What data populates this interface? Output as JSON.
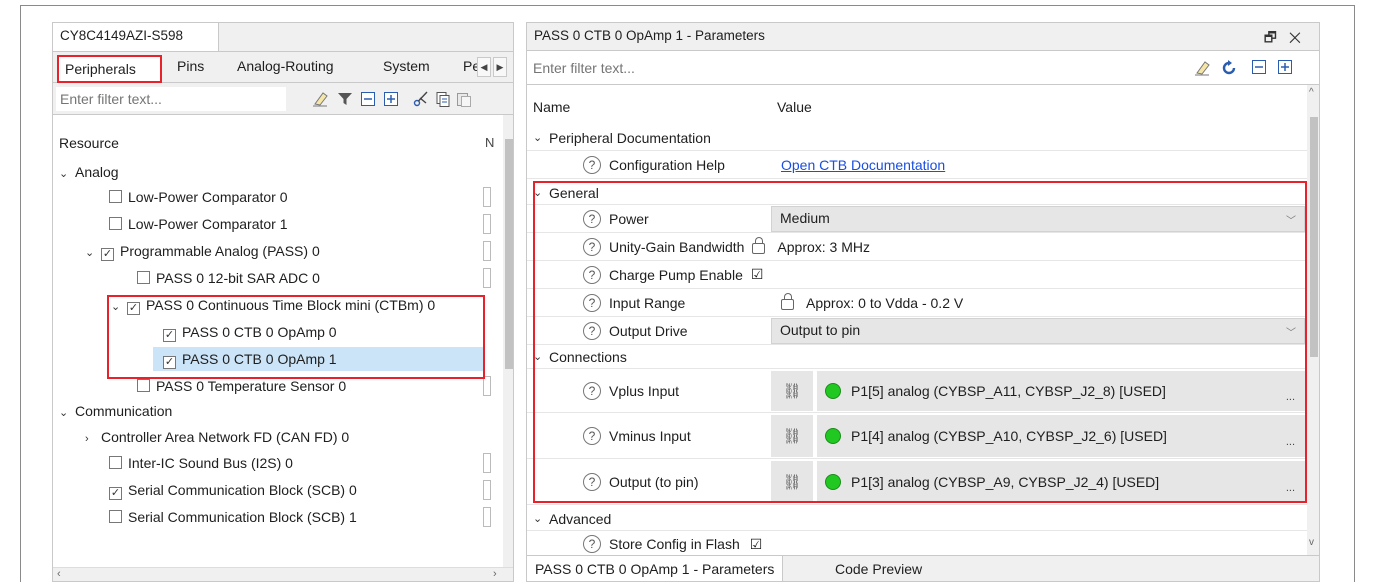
{
  "left_panel": {
    "doc_title": "CY8C4149AZI-S598",
    "tabs": [
      "Peripherals",
      "Pins",
      "Analog-Routing",
      "System",
      "Pe"
    ],
    "filter_placeholder": "Enter filter text...",
    "resource_header": "Resource",
    "tree": [
      {
        "label": "Analog",
        "level": 0,
        "expanded": true,
        "checkbox": null
      },
      {
        "label": "Low-Power Comparator 0",
        "level": 2,
        "checkbox": false
      },
      {
        "label": "Low-Power Comparator 1",
        "level": 2,
        "checkbox": false
      },
      {
        "label": "Programmable Analog (PASS) 0",
        "level": 1,
        "expanded": true,
        "checkbox": true
      },
      {
        "label": "PASS 0 12-bit SAR ADC 0",
        "level": 3,
        "checkbox": false
      },
      {
        "label": "PASS 0 Continuous Time Block mini (CTBm) 0",
        "level": 2,
        "expanded": true,
        "checkbox": true
      },
      {
        "label": "PASS 0 CTB 0 OpAmp 0",
        "level": 4,
        "checkbox": true
      },
      {
        "label": "PASS 0 CTB 0 OpAmp 1",
        "level": 4,
        "checkbox": true,
        "selected": true
      },
      {
        "label": "PASS 0 Temperature Sensor 0",
        "level": 3,
        "checkbox": false
      },
      {
        "label": "Communication",
        "level": 0,
        "expanded": true,
        "checkbox": null
      },
      {
        "label": "Controller Area Network FD (CAN FD) 0",
        "level": 1,
        "expanded": false,
        "checkbox": null
      },
      {
        "label": "Inter-IC Sound Bus (I2S) 0",
        "level": 2,
        "checkbox": false
      },
      {
        "label": "Serial Communication Block (SCB) 0",
        "level": 2,
        "checkbox": true
      },
      {
        "label": "Serial Communication Block (SCB) 1",
        "level": 2,
        "checkbox": false
      }
    ]
  },
  "right_panel": {
    "title": "PASS 0 CTB 0 OpAmp 1 - Parameters",
    "filter_placeholder": "Enter filter text...",
    "col_name": "Name",
    "col_value": "Value",
    "sections": {
      "peripheral_doc": "Peripheral Documentation",
      "general": "General",
      "connections": "Connections",
      "advanced": "Advanced"
    },
    "params": {
      "config_help": {
        "name": "Configuration Help",
        "value": "Open CTB Documentation"
      },
      "power": {
        "name": "Power",
        "value": "Medium"
      },
      "ugb": {
        "name": "Unity-Gain Bandwidth",
        "value": "Approx: 3 MHz"
      },
      "charge_pump": {
        "name": "Charge Pump Enable",
        "value": "☑"
      },
      "input_range": {
        "name": "Input Range",
        "value": "Approx: 0 to Vdda - 0.2 V"
      },
      "output_drive": {
        "name": "Output Drive",
        "value": "Output to pin"
      },
      "vplus": {
        "name": "Vplus Input",
        "value": "P1[5] analog (CYBSP_A11, CYBSP_J2_8) [USED]"
      },
      "vminus": {
        "name": "Vminus Input",
        "value": "P1[4] analog (CYBSP_A10, CYBSP_J2_6) [USED]"
      },
      "output_pin": {
        "name": "Output (to pin)",
        "value": "P1[3] analog (CYBSP_A9, CYBSP_J2_4) [USED]"
      },
      "store_flash": {
        "name": "Store Config in Flash",
        "value": "☑"
      }
    },
    "bottom_tabs": [
      "PASS 0 CTB 0 OpAmp 1 - Parameters",
      "Code Preview"
    ]
  },
  "colors": {
    "highlight": "#e8212a",
    "selection": "#cce4f7",
    "status_used": "#21c821",
    "link": "#1a4ee0"
  },
  "icons": [
    "eraser-icon",
    "filter-icon",
    "collapse-all-icon",
    "expand-all-icon",
    "cut-icon",
    "copy-icon",
    "paste-icon",
    "refresh-icon",
    "link-icon",
    "lock-icon",
    "help-icon",
    "float-window-icon",
    "close-icon"
  ]
}
